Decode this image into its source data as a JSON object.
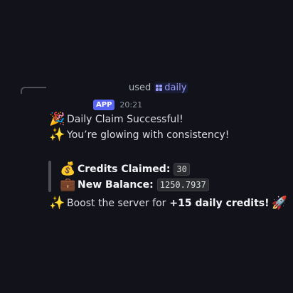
{
  "reply": {
    "used_text": "used",
    "command": "daily"
  },
  "header": {
    "badge": "APP",
    "timestamp": "20:21"
  },
  "message": {
    "line1": {
      "emoji": "🎉",
      "text": "Daily Claim Successful!"
    },
    "line2": {
      "emoji": "✨",
      "text": "You’re glowing with consistency!"
    },
    "credits": {
      "emoji": "💰",
      "label": "Credits Claimed:",
      "value": "30"
    },
    "balance": {
      "emoji": "💼",
      "label": "New Balance:",
      "value": "1250.7937"
    },
    "boost": {
      "emoji": "✨",
      "prefix": "Boost the server for",
      "bold": "+15 daily credits!",
      "end_emoji": "🚀"
    }
  },
  "colors": {
    "background": "#12121b",
    "accent": "#5865f2",
    "command": "#949cf7"
  }
}
